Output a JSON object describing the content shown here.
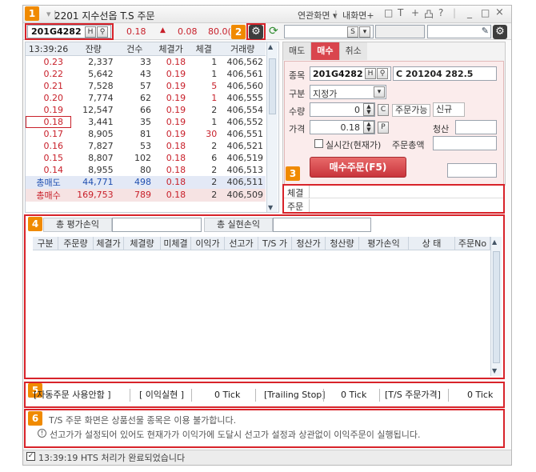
{
  "window": {
    "title": "2201 지수선옵 T.S 주문",
    "menu_links": [
      "연관화면",
      "내화면+"
    ],
    "toolbar_glyphs": [
      "□",
      "T",
      "+",
      "凸",
      "?",
      "|",
      "_",
      "□",
      "×"
    ]
  },
  "badges": [
    "1",
    "2",
    "3",
    "4",
    "5",
    "6"
  ],
  "quote_bar": {
    "code": "201G4282",
    "h_btn": "H",
    "price": "0.18",
    "change_arrow": "▲",
    "change": "0.08",
    "rate": "80.0(",
    "account_s": "S"
  },
  "ticks": {
    "columns": [
      "13:39:26",
      "잔량",
      "건수",
      "체결가",
      "체결",
      "거래량"
    ],
    "rows": [
      {
        "price": "0.23",
        "qty": "2,337",
        "cnt": "33",
        "trade": "0.18",
        "vol": "1",
        "total": "406,562",
        "side": "ask"
      },
      {
        "price": "0.22",
        "qty": "5,642",
        "cnt": "43",
        "trade": "0.19",
        "vol": "1",
        "total": "406,561",
        "side": "ask"
      },
      {
        "price": "0.21",
        "qty": "7,528",
        "cnt": "57",
        "trade": "0.19",
        "vol": "5",
        "total": "406,560",
        "side": "ask"
      },
      {
        "price": "0.20",
        "qty": "7,774",
        "cnt": "62",
        "trade": "0.19",
        "vol": "1",
        "total": "406,555",
        "side": "ask"
      },
      {
        "price": "0.19",
        "qty": "12,547",
        "cnt": "66",
        "trade": "0.19",
        "vol": "2",
        "total": "406,554",
        "side": "ask"
      },
      {
        "price": "0.18",
        "qty": "3,441",
        "cnt": "35",
        "trade": "0.19",
        "vol": "1",
        "total": "406,552",
        "side": "current"
      },
      {
        "price": "0.17",
        "qty": "8,905",
        "cnt": "81",
        "trade": "0.19",
        "vol": "30",
        "total": "406,551",
        "side": "bid"
      },
      {
        "price": "0.16",
        "qty": "7,827",
        "cnt": "53",
        "trade": "0.18",
        "vol": "2",
        "total": "406,521",
        "side": "bid"
      },
      {
        "price": "0.15",
        "qty": "8,807",
        "cnt": "102",
        "trade": "0.18",
        "vol": "6",
        "total": "406,519",
        "side": "bid"
      },
      {
        "price": "0.14",
        "qty": "8,955",
        "cnt": "80",
        "trade": "0.18",
        "vol": "2",
        "total": "406,513",
        "side": "bid"
      }
    ],
    "total_ask": {
      "label": "총매도",
      "qty": "44,771",
      "cnt": "498",
      "trade": "0.18",
      "vol": "2",
      "total": "406,511"
    },
    "total_bid": {
      "label": "총매수",
      "qty": "169,753",
      "cnt": "789",
      "trade": "0.18",
      "vol": "2",
      "total": "406,509"
    }
  },
  "order": {
    "tabs": [
      "매도",
      "매수",
      "취소"
    ],
    "active_tab": 1,
    "code_label": "종목",
    "code": "201G4282",
    "code_name": "C 201204 282.5",
    "type_label": "구분",
    "type_value": "지정가",
    "qty_label": "수량",
    "qty_value": "0",
    "c_btn": "C",
    "avail_label": "주문가능",
    "new_label": "신규",
    "price_label": "가격",
    "price_value": "0.18",
    "p_btn": "P",
    "settle_label": "청산",
    "realtime_label": "실시간(현재가)",
    "amount_label": "주문총액",
    "submit_label": "매수주문(F5)"
  },
  "fill_panel": {
    "fill_label": "체결",
    "order_label": "주문"
  },
  "pnl": {
    "eval_label": "총 평가손익",
    "realized_label": "총 실현손익",
    "columns": [
      "구분",
      "주문량",
      "체결가",
      "체결량",
      "미체결",
      "이익가",
      "선고가",
      "T/S 가",
      "청산가",
      "청산량",
      "평가손익",
      "상 태",
      "주문No"
    ]
  },
  "ts_settings": {
    "items": [
      "[자동주문 사용안함 ]",
      "[ 이익실현 ]",
      "0 Tick",
      "[Trailing Stop]",
      "0 Tick",
      "[T/S 주문가격]",
      "0 Tick"
    ]
  },
  "notices": {
    "line1": "T/S 주문 화면은 상품선물 종목은 이용 불가합니다.",
    "line2_icon": "!",
    "line2": "선고가가 설정되어 있어도 현재가가 이익가에 도달시 선고가 설정과 상관없이 이익주문이 실행됩니다."
  },
  "status": {
    "text": "13:39:19  HTS 처리가 완료되었습니다"
  }
}
